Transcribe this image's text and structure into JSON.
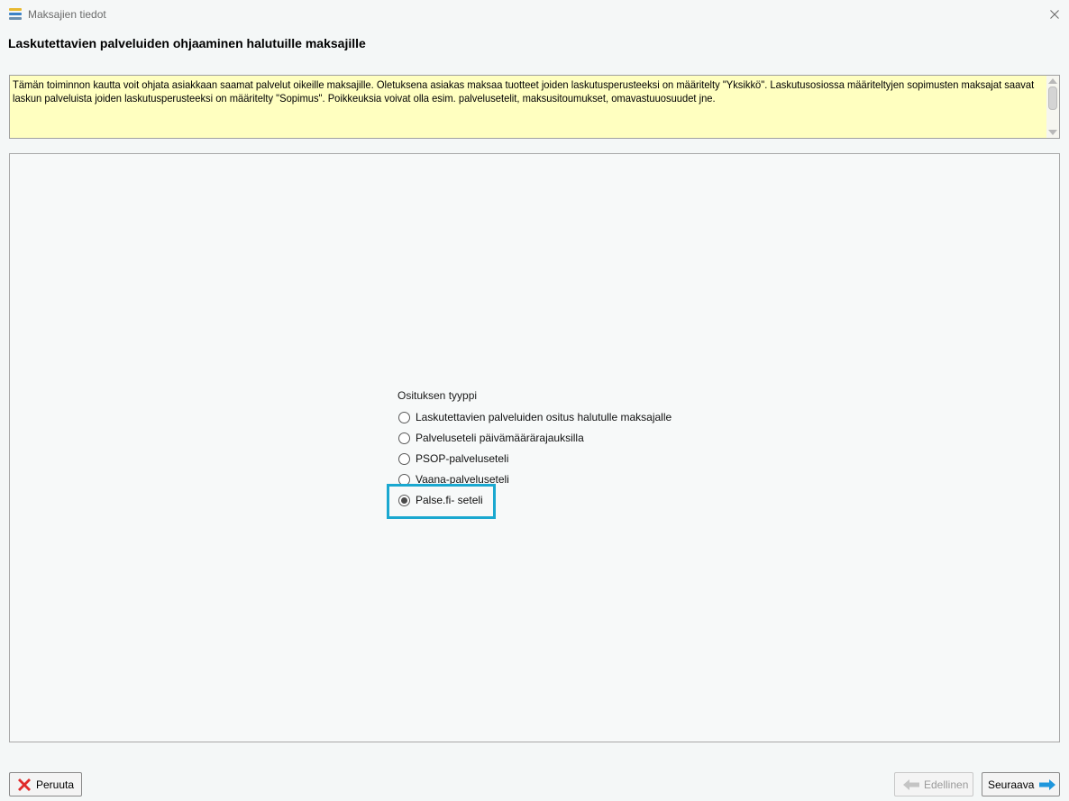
{
  "window": {
    "title": "Maksajien tiedot",
    "app_icon": "stack-icon",
    "close_icon": "close-icon"
  },
  "heading": "Laskutettavien palveluiden ohjaaminen halutuille maksajille",
  "info": {
    "text": "Tämän toiminnon kautta voit ohjata asiakkaan saamat palvelut oikeille maksajille. Oletuksena asiakas maksaa tuotteet joiden laskutusperusteeksi on määritelty \"Yksikkö\". Laskutusosiossa määriteltyjen sopimusten maksajat saavat laskun palveluista joiden laskutusperusteeksi on määritelty \"Sopimus\". Poikkeuksia voivat olla esim. palvelusetelit, maksusitoumukset, omavastuuosuudet jne.",
    "background": "#ffffc0"
  },
  "division_type": {
    "label": "Osituksen tyyppi",
    "options": [
      {
        "label": "Laskutettavien palveluiden ositus halutulle maksajalle",
        "checked": false
      },
      {
        "label": "Palveluseteli päivämäärärajauksilla",
        "checked": false
      },
      {
        "label": "PSOP-palveluseteli",
        "checked": false
      },
      {
        "label": "Vaana-palveluseteli",
        "checked": false
      },
      {
        "label": "Palse.fi- seteli",
        "checked": true
      }
    ],
    "highlight_color": "#1aa8d0"
  },
  "buttons": {
    "cancel": {
      "label": "Peruuta",
      "icon": "red-x-icon"
    },
    "previous": {
      "label": "Edellinen",
      "icon": "arrow-left-icon",
      "disabled": true
    },
    "next": {
      "label": "Seuraava",
      "icon": "arrow-right-icon"
    }
  }
}
